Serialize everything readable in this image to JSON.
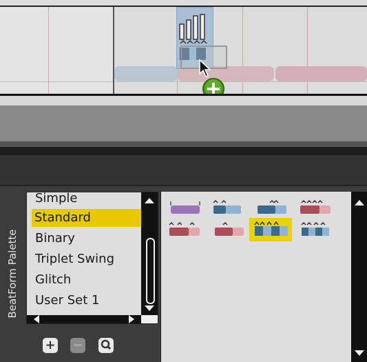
{
  "palette": {
    "title": "BeatForm Palette",
    "list_items": [
      "Simple",
      "Standard",
      "Binary",
      "Triplet Swing",
      "Glitch",
      "User Set 1"
    ],
    "selected_item": "Standard",
    "buttons": {
      "add": "+",
      "remove": "−",
      "zoom_icon": "magnifier-icon"
    },
    "beatforms": [
      {
        "id": "bf-1",
        "selected": false
      },
      {
        "id": "bf-2",
        "selected": false
      },
      {
        "id": "bf-3",
        "selected": false
      },
      {
        "id": "bf-4",
        "selected": false
      },
      {
        "id": "bf-5",
        "selected": false
      },
      {
        "id": "bf-6",
        "selected": false
      },
      {
        "id": "bf-7",
        "selected": true
      },
      {
        "id": "bf-8",
        "selected": false
      }
    ]
  },
  "colors": {
    "selection": "#e7c900",
    "blue": "#3c6a8d",
    "light_blue": "#8fb3d1",
    "red": "#a94d58",
    "pink": "#e3a7ab",
    "purple": "#9b73b8",
    "add_badge": "#4f9a1c"
  }
}
